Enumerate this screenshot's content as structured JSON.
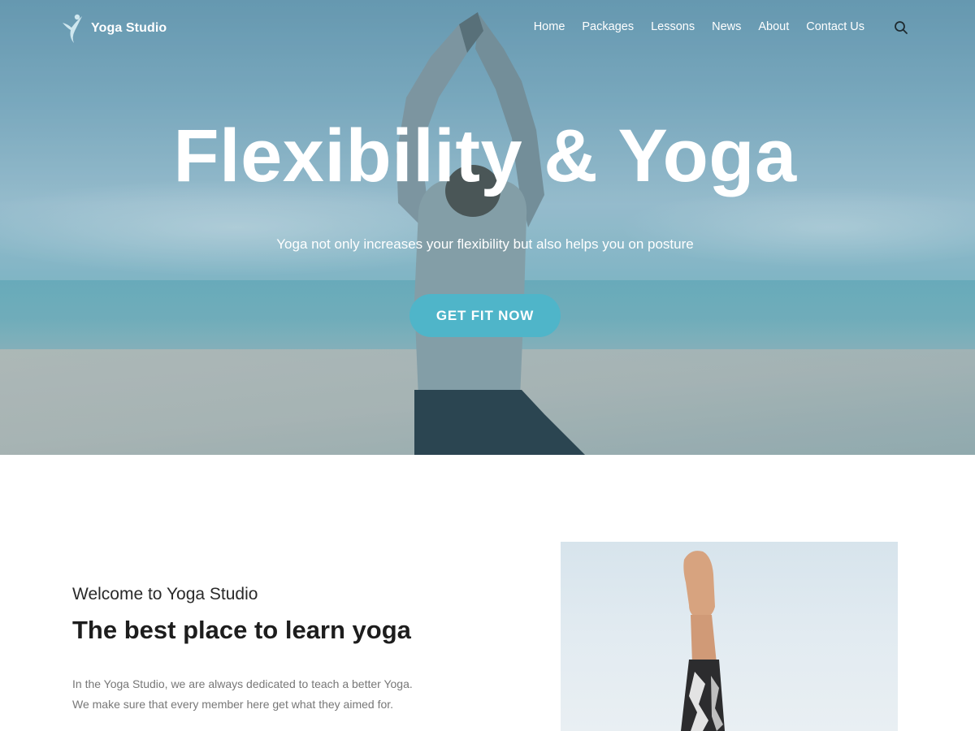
{
  "brand": {
    "name": "Yoga Studio",
    "logo_icon": "yoga-figure-icon"
  },
  "nav": {
    "items": [
      {
        "label": "Home"
      },
      {
        "label": "Packages"
      },
      {
        "label": "Lessons"
      },
      {
        "label": "News"
      },
      {
        "label": "About"
      },
      {
        "label": "Contact Us"
      }
    ],
    "search_icon": "search-icon"
  },
  "hero": {
    "title": "Flexibility & Yoga",
    "subtitle": "Yoga not only increases your flexibility but also helps you on posture",
    "cta_label": "GET FIT NOW"
  },
  "welcome": {
    "kicker": "Welcome to Yoga Studio",
    "title": "The best place to learn yoga",
    "body": "In the Yoga Studio, we are always dedicated to teach a better Yoga. We make sure that every member  here get what they aimed for."
  },
  "colors": {
    "accent": "#4fb5c9",
    "text_dark": "#1d1d1d",
    "text_muted": "#777777"
  }
}
